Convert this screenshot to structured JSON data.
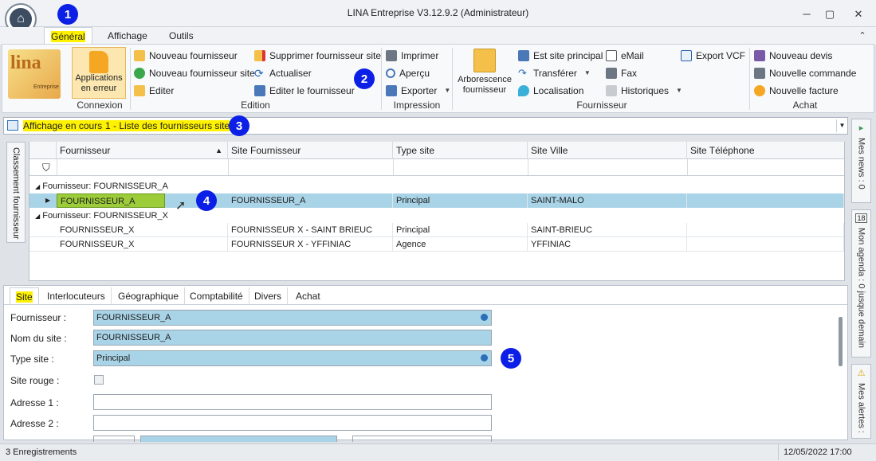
{
  "window": {
    "title": "LINA Entreprise  V3.12.9.2  (Administrateur)",
    "minimize_label": "─",
    "maximize_label": "▢",
    "close_label": "✕",
    "collapse_label": "⌃"
  },
  "ribbon_tabs": [
    {
      "label": "Général"
    },
    {
      "label": "Affichage"
    },
    {
      "label": "Outils"
    }
  ],
  "callouts": [
    "1",
    "2",
    "3",
    "4",
    "5"
  ],
  "ribbon": {
    "brand_text": "lina",
    "brand_sub": "Entreprise",
    "connexion": {
      "button_label_1": "Applications",
      "button_label_2": "en erreur",
      "group_label": "Connexion"
    },
    "edition": {
      "items": [
        "Nouveau fournisseur",
        "Nouveau fournisseur site",
        "Editer",
        "Supprimer fournisseur site",
        "Actualiser",
        "Editer le fournisseur"
      ],
      "group_label": "Edition"
    },
    "impression": {
      "items": [
        "Imprimer",
        "Aperçu",
        "Exporter"
      ],
      "group_label": "Impression"
    },
    "fournisseur": {
      "arbo_label_1": "Arborescence",
      "arbo_label_2": "fournisseur",
      "items": [
        "Est site principal",
        "Transférer",
        "Localisation",
        "eMail",
        "Fax",
        "Historiques",
        "Export VCF"
      ],
      "group_label": "Fournisseur"
    },
    "achat": {
      "items": [
        "Nouveau devis",
        "Nouvelle commande",
        "Nouvelle facture"
      ],
      "group_label": "Achat"
    }
  },
  "view_bar": {
    "label": "Affichage en cours :",
    "value": "1 - Liste des fournisseurs site"
  },
  "grid": {
    "side_label": "Classement fournisseur",
    "columns": [
      "Fournisseur",
      "Site Fournisseur",
      "Type site",
      "Site Ville",
      "Site Téléphone"
    ],
    "groups": [
      {
        "label": "Fournisseur: FOURNISSEUR_A",
        "rows": [
          [
            "FOURNISSEUR_A",
            "FOURNISSEUR_A",
            "Principal",
            "SAINT-MALO",
            ""
          ]
        ]
      },
      {
        "label": "Fournisseur: FOURNISSEUR_X",
        "rows": [
          [
            "FOURNISSEUR_X",
            "FOURNISSEUR X - SAINT BRIEUC",
            "Principal",
            "SAINT-BRIEUC",
            ""
          ],
          [
            "FOURNISSEUR_X",
            "FOURNISSEUR X - YFFINIAC",
            "Agence",
            "YFFINIAC",
            ""
          ]
        ]
      }
    ]
  },
  "side_tabs": [
    {
      "label": "Mes news : 0"
    },
    {
      "label": "Mon agenda : 0 jusque demain",
      "day": "18"
    },
    {
      "label": "Mes alertes :"
    }
  ],
  "detail_tabs": [
    "Site",
    "Interlocuteurs",
    "Géographique",
    "Comptabilité",
    "Divers",
    "Achat"
  ],
  "form": {
    "fournisseur_label": "Fournisseur :",
    "fournisseur_value": "FOURNISSEUR_A",
    "nom_site_label": "Nom du site :",
    "nom_site_value": "FOURNISSEUR_A",
    "type_site_label": "Type site :",
    "type_site_value": "Principal",
    "site_rouge_label": "Site rouge :",
    "adresse1_label": "Adresse 1 :",
    "adresse1_value": "",
    "adresse2_label": "Adresse 2 :",
    "adresse2_value": ""
  },
  "status": {
    "records": "3 Enregistrements",
    "datetime": "12/05/2022 17:00"
  },
  "colors": {
    "highlight": "#fff200",
    "callout": "#0c1fe6",
    "selection": "#a9d3e6",
    "accent_orange": "#f5a623"
  }
}
